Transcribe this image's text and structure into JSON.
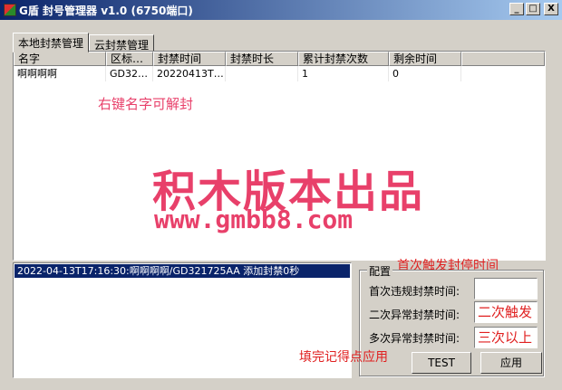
{
  "window": {
    "title": "G盾  封号管理器  v1.0  (6750端口)",
    "controls": {
      "minimize": "_",
      "maximize": "□",
      "close": "X"
    }
  },
  "tabs": [
    {
      "label": "本地封禁管理",
      "active": true
    },
    {
      "label": "云封禁管理",
      "active": false
    }
  ],
  "table": {
    "columns": [
      "名字",
      "区标…",
      "封禁时间",
      "封禁时长",
      "累计封禁次数",
      "剩余时间"
    ],
    "rows": [
      [
        "啊啊啊啊",
        "GD32…",
        "20220413T…",
        "",
        "1",
        "0"
      ]
    ]
  },
  "overlays": {
    "hint_unban": "右键名字可解封",
    "watermark_cn": "积木版本出品",
    "watermark_url": "www.gmbb8.com",
    "hint_first": "首次触发封停时间",
    "hint_apply": "填完记得点应用"
  },
  "log": {
    "lines": [
      "2022-04-13T17:16:30:啊啊啊啊/GD321725AA 添加封禁0秒"
    ]
  },
  "config": {
    "title": "配置",
    "fields": [
      {
        "label": "首次违规封禁时间:",
        "value": ""
      },
      {
        "label": "二次异常封禁时间:",
        "value": "二次触发"
      },
      {
        "label": "多次异常封禁时间:",
        "value": "三次以上"
      }
    ],
    "buttons": {
      "test": "TEST",
      "apply": "应用"
    }
  },
  "colors": {
    "titlebar": "#0a246a",
    "watermark": "#e8406a",
    "hint": "#e02020"
  }
}
